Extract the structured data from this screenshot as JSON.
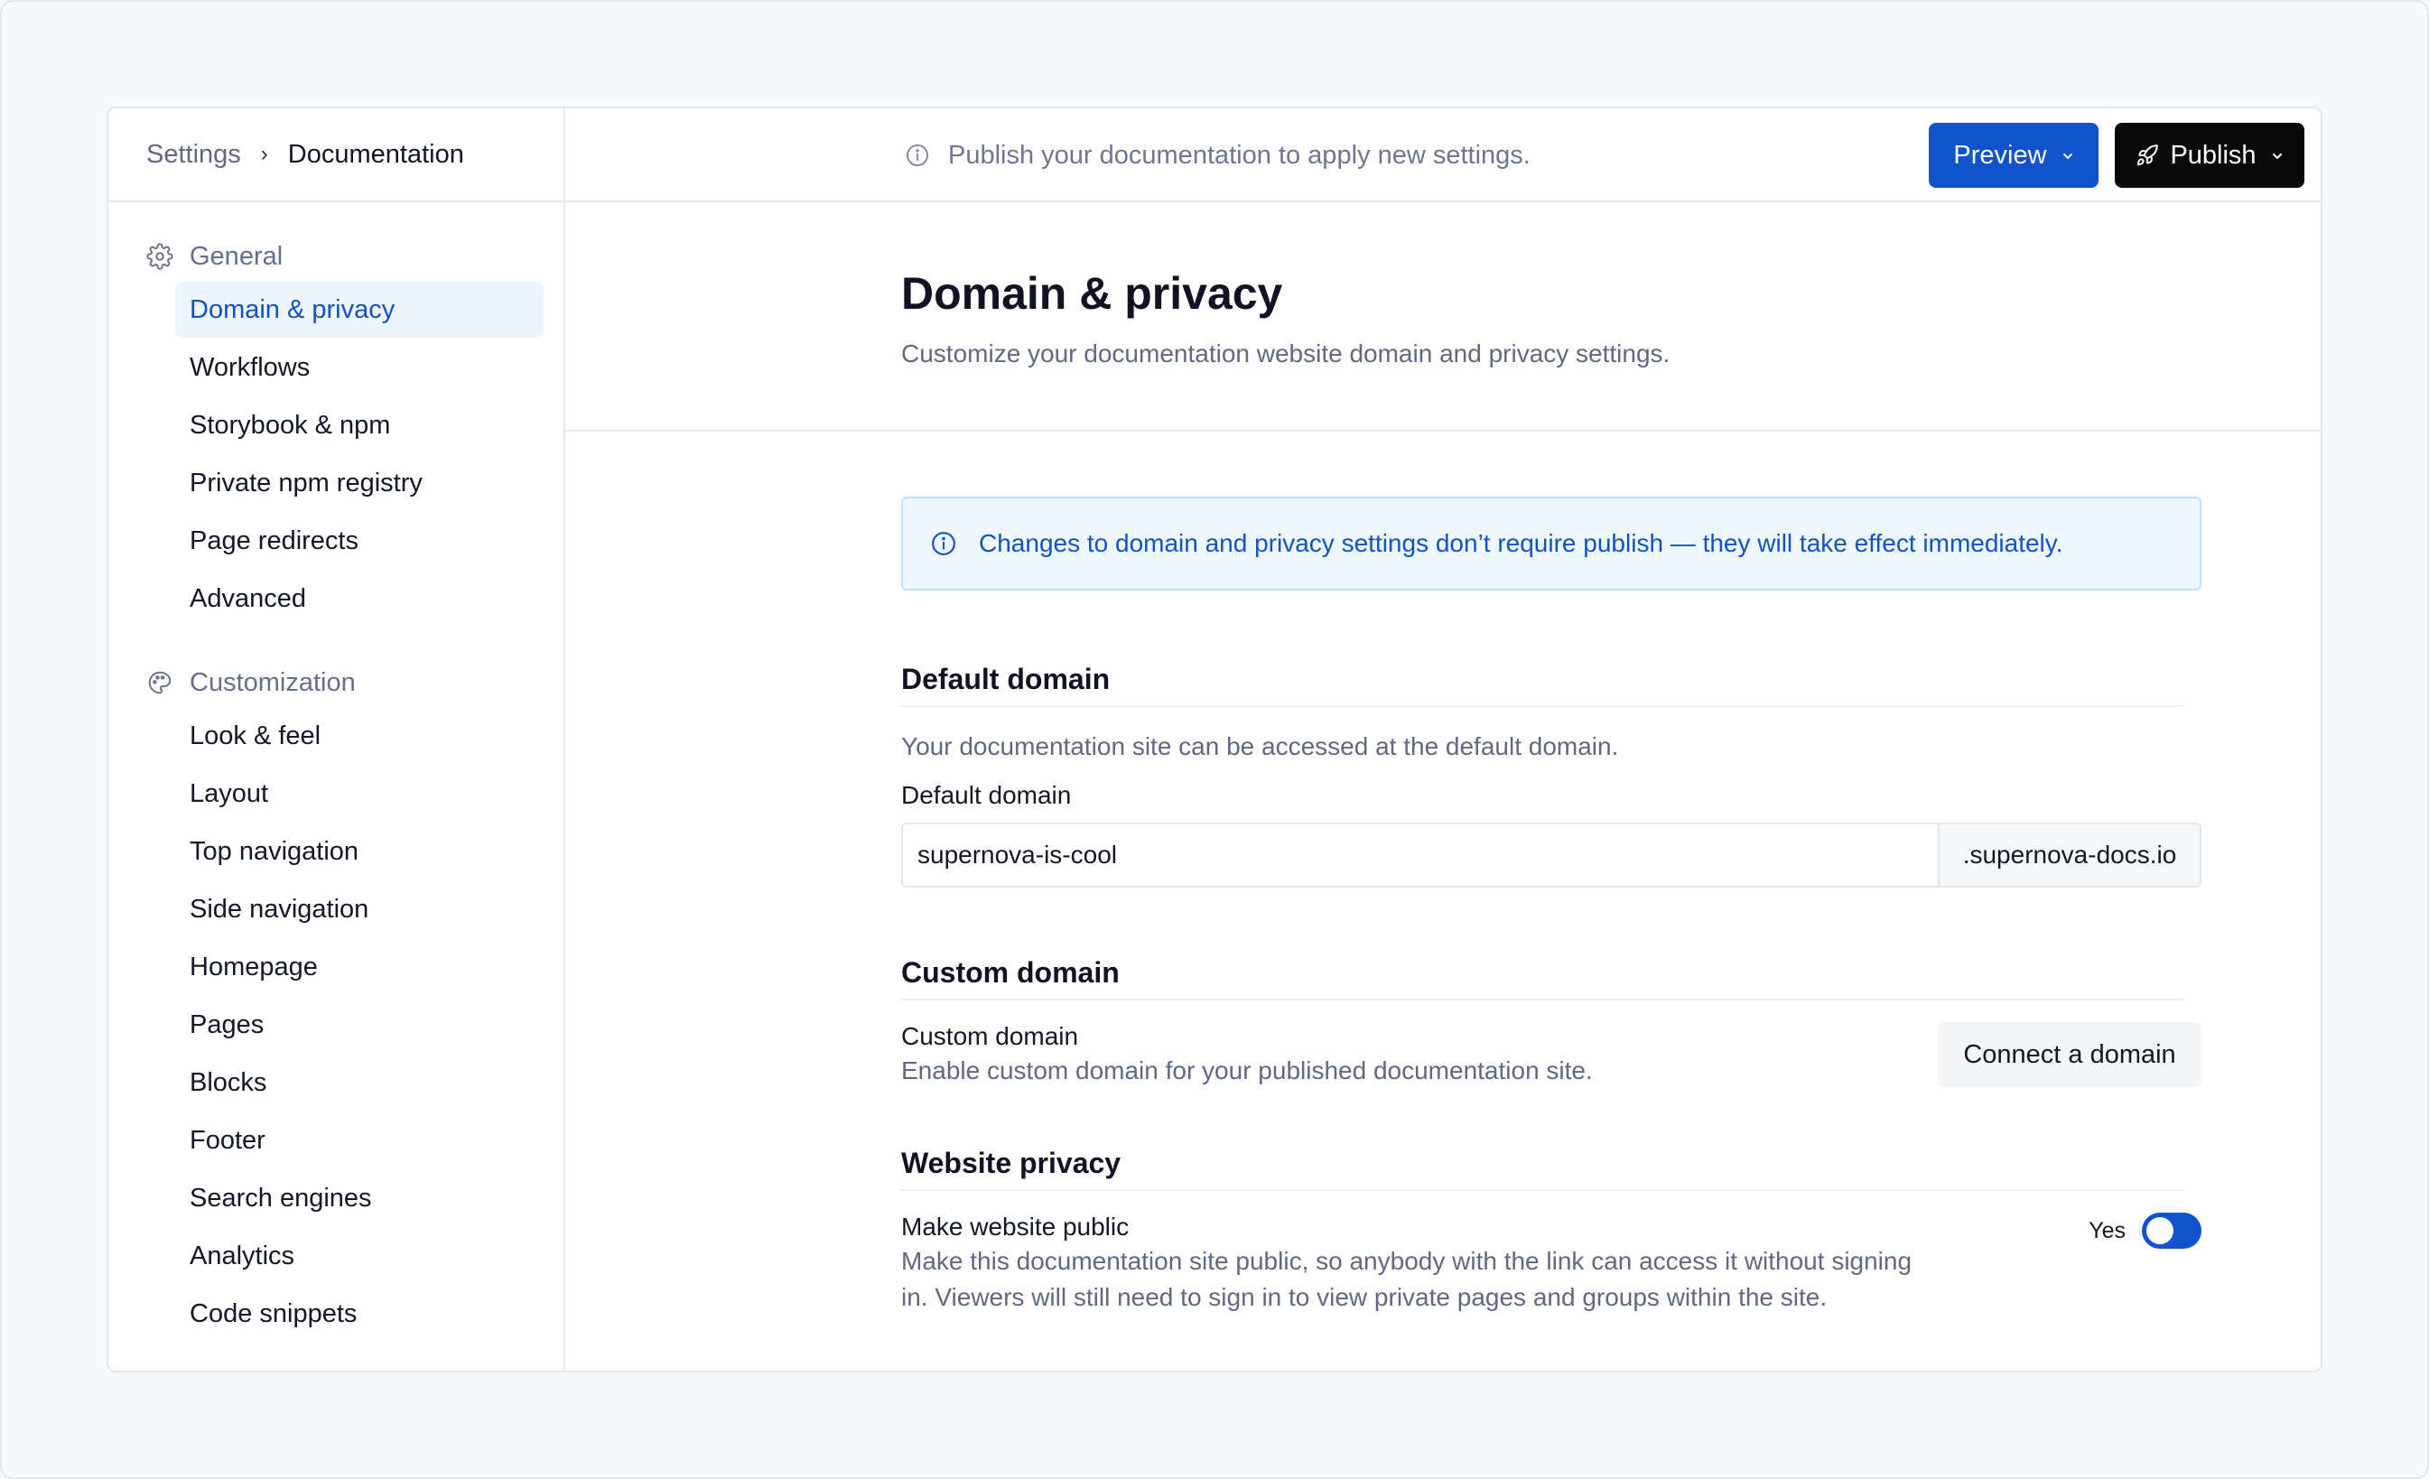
{
  "breadcrumb": {
    "root": "Settings",
    "separator": "›",
    "current": "Documentation"
  },
  "topbar": {
    "notice": "Publish your documentation to apply new settings.",
    "preview_label": "Preview",
    "publish_label": "Publish"
  },
  "sidebar": {
    "groups": [
      {
        "label": "General",
        "icon": "gear-icon",
        "items": [
          "Domain & privacy",
          "Workflows",
          "Storybook & npm",
          "Private npm registry",
          "Page redirects",
          "Advanced"
        ]
      },
      {
        "label": "Customization",
        "icon": "palette-icon",
        "items": [
          "Look & feel",
          "Layout",
          "Top navigation",
          "Side navigation",
          "Homepage",
          "Pages",
          "Blocks",
          "Footer",
          "Search engines",
          "Analytics",
          "Code snippets"
        ]
      }
    ],
    "active_item": "Domain & privacy"
  },
  "page": {
    "title": "Domain & privacy",
    "subtitle": "Customize your documentation website domain and privacy settings."
  },
  "banner": {
    "text": "Changes to domain and privacy settings don’t require publish — they will take effect immediately."
  },
  "default_domain": {
    "title": "Default domain",
    "description": "Your documentation site can be accessed at the default domain.",
    "field_label": "Default domain",
    "value": "supernova-is-cool",
    "suffix": ".supernova-docs.io"
  },
  "custom_domain": {
    "title": "Custom domain",
    "label": "Custom domain",
    "description": "Enable custom domain for your published documentation site.",
    "button_label": "Connect a domain"
  },
  "privacy": {
    "title": "Website privacy",
    "label": "Make website public",
    "description_line1": "Make this documentation site public, so anybody with the link can access it without signing",
    "description_line2": "in. Viewers will still need to sign in to view private pages and groups within the site.",
    "toggle_label": "Yes",
    "toggle_on": true
  },
  "colors": {
    "accent": "#1152cd",
    "publish": "#0a0a0a",
    "active_bg": "#edf5ff",
    "banner_bg": "#edf7fe"
  }
}
